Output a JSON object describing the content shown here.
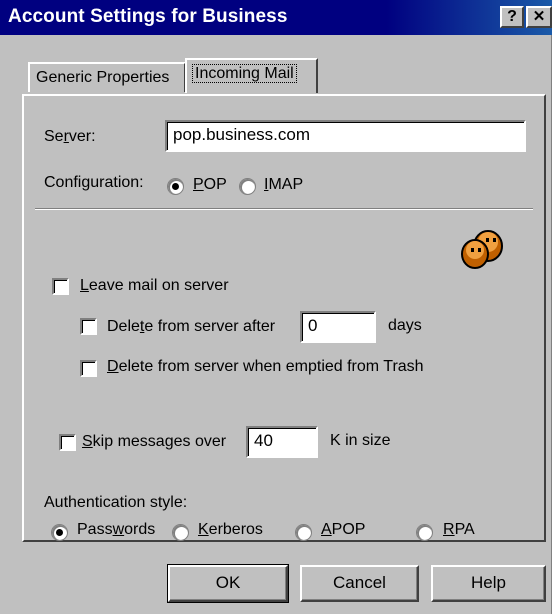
{
  "window": {
    "title": "Account Settings for Business",
    "help_glyph": "?",
    "close_glyph": "✕"
  },
  "tabs": [
    {
      "label": "Generic Properties"
    },
    {
      "label": "Incoming Mail"
    }
  ],
  "server": {
    "label": "Server:",
    "value": "pop.business.com"
  },
  "configuration": {
    "label": "Configuration:",
    "options": [
      {
        "label": "POP",
        "selected": true
      },
      {
        "label": "IMAP",
        "selected": false
      }
    ]
  },
  "icon": {
    "name": "mail-server-faces-icon"
  },
  "options": {
    "leave_mail": {
      "label": "Leave mail on server",
      "checked": false
    },
    "delete_after": {
      "label": "Delete from server after",
      "value": "0",
      "suffix": "days",
      "checked": false
    },
    "delete_trash": {
      "label": "Delete from server when emptied from Trash",
      "checked": false
    },
    "skip_messages": {
      "label": "Skip messages over",
      "value": "40",
      "suffix": "K in size",
      "checked": false
    }
  },
  "authentication": {
    "label": "Authentication style:",
    "options": [
      {
        "label": "Passwords",
        "selected": true
      },
      {
        "label": "Kerberos",
        "selected": false
      },
      {
        "label": "APOP",
        "selected": false
      },
      {
        "label": "RPA",
        "selected": false
      }
    ]
  },
  "buttons": {
    "ok": "OK",
    "cancel": "Cancel",
    "help": "Help"
  }
}
